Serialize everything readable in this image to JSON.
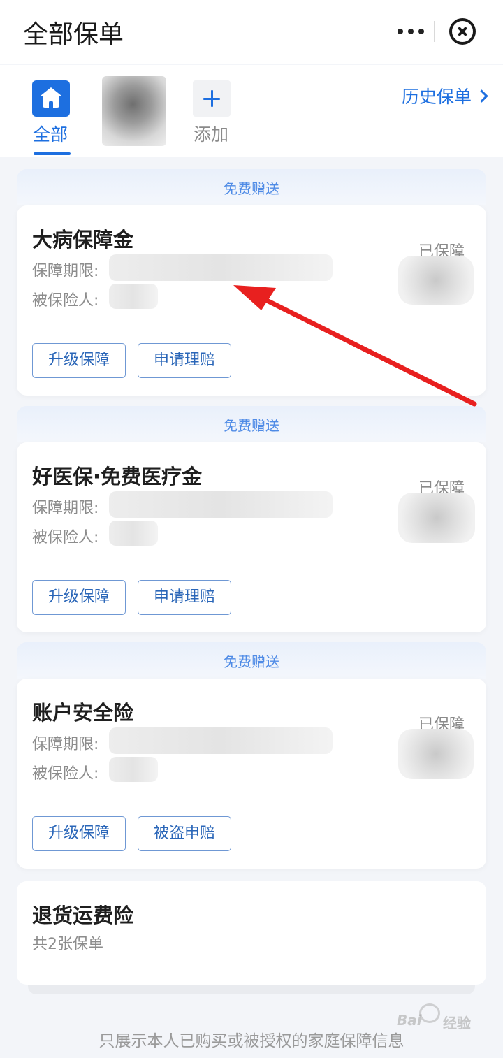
{
  "header": {
    "title": "全部保单"
  },
  "tabs": {
    "all_label": "全部",
    "add_label": "添加",
    "history_link": "历史保单"
  },
  "ribbon_text": "免费赠送",
  "field_labels": {
    "period": "保障期限:",
    "insured": "被保险人:"
  },
  "policies": [
    {
      "name": "大病保障金",
      "status": "已保障",
      "buttons": [
        "升级保障",
        "申请理赔"
      ]
    },
    {
      "name": "好医保·免费医疗金",
      "status": "已保障",
      "buttons": [
        "升级保障",
        "申请理赔"
      ]
    },
    {
      "name": "账户安全险",
      "status": "已保障",
      "buttons": [
        "升级保障",
        "被盗申赔"
      ]
    }
  ],
  "shipping": {
    "name": "退货运费险",
    "subtitle": "共2张保单"
  },
  "footer_note": "只展示本人已购买或被授权的家庭保障信息",
  "watermark": {
    "brand": "Bai",
    "brand_cn": "经验"
  },
  "colors": {
    "accent": "#1d6fe0",
    "annotation_arrow": "#e8201f"
  }
}
